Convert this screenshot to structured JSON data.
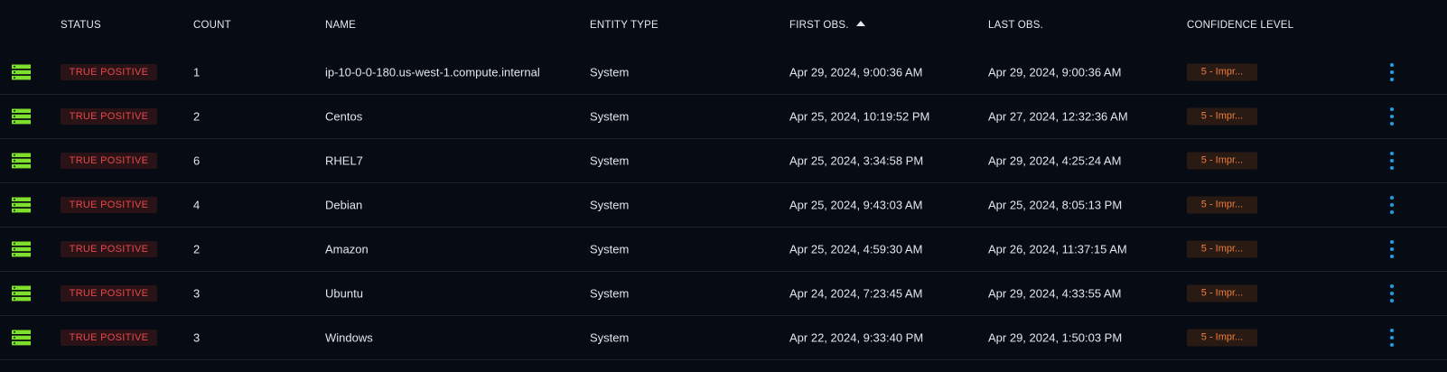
{
  "columns": {
    "status": "STATUS",
    "count": "COUNT",
    "name": "NAME",
    "entity_type": "ENTITY TYPE",
    "first_obs": "FIRST OBS.",
    "last_obs": "LAST OBS.",
    "confidence": "CONFIDENCE LEVEL"
  },
  "sort": {
    "column": "first_obs",
    "direction": "ascending-arrow"
  },
  "colors": {
    "icon_green": "#7ee02a",
    "status_red": "#e8474c",
    "confidence_orange": "#ef7e3c",
    "kebab_blue": "#1fa0ec"
  },
  "rows": [
    {
      "icon": "server-icon",
      "status": "TRUE POSITIVE",
      "count": "1",
      "name": "ip-10-0-0-180.us-west-1.compute.internal",
      "entity_type": "System",
      "first_obs": "Apr 29, 2024, 9:00:36 AM",
      "last_obs": "Apr 29, 2024, 9:00:36 AM",
      "confidence": "5 - Impr..."
    },
    {
      "icon": "server-icon",
      "status": "TRUE POSITIVE",
      "count": "2",
      "name": "Centos",
      "entity_type": "System",
      "first_obs": "Apr 25, 2024, 10:19:52 PM",
      "last_obs": "Apr 27, 2024, 12:32:36 AM",
      "confidence": "5 - Impr..."
    },
    {
      "icon": "server-icon",
      "status": "TRUE POSITIVE",
      "count": "6",
      "name": "RHEL7",
      "entity_type": "System",
      "first_obs": "Apr 25, 2024, 3:34:58 PM",
      "last_obs": "Apr 29, 2024, 4:25:24 AM",
      "confidence": "5 - Impr..."
    },
    {
      "icon": "server-icon",
      "status": "TRUE POSITIVE",
      "count": "4",
      "name": "Debian",
      "entity_type": "System",
      "first_obs": "Apr 25, 2024, 9:43:03 AM",
      "last_obs": "Apr 25, 2024, 8:05:13 PM",
      "confidence": "5 - Impr..."
    },
    {
      "icon": "server-icon",
      "status": "TRUE POSITIVE",
      "count": "2",
      "name": "Amazon",
      "entity_type": "System",
      "first_obs": "Apr 25, 2024, 4:59:30 AM",
      "last_obs": "Apr 26, 2024, 11:37:15 AM",
      "confidence": "5 - Impr..."
    },
    {
      "icon": "server-icon",
      "status": "TRUE POSITIVE",
      "count": "3",
      "name": "Ubuntu",
      "entity_type": "System",
      "first_obs": "Apr 24, 2024, 7:23:45 AM",
      "last_obs": "Apr 29, 2024, 4:33:55 AM",
      "confidence": "5 - Impr..."
    },
    {
      "icon": "server-icon",
      "status": "TRUE POSITIVE",
      "count": "3",
      "name": "Windows",
      "entity_type": "System",
      "first_obs": "Apr 22, 2024, 9:33:40 PM",
      "last_obs": "Apr 29, 2024, 1:50:03 PM",
      "confidence": "5 - Impr..."
    }
  ]
}
